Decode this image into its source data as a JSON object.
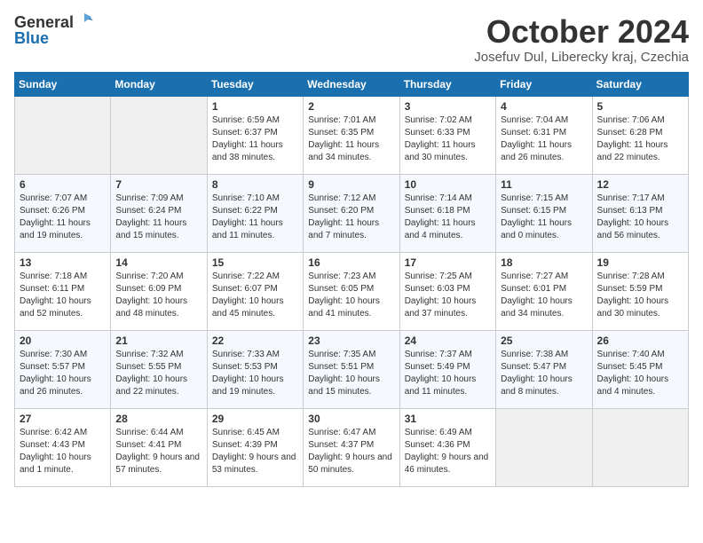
{
  "header": {
    "logo_general": "General",
    "logo_blue": "Blue",
    "month": "October 2024",
    "location": "Josefuv Dul, Liberecky kraj, Czechia"
  },
  "weekdays": [
    "Sunday",
    "Monday",
    "Tuesday",
    "Wednesday",
    "Thursday",
    "Friday",
    "Saturday"
  ],
  "weeks": [
    [
      {
        "day": "",
        "info": ""
      },
      {
        "day": "",
        "info": ""
      },
      {
        "day": "1",
        "info": "Sunrise: 6:59 AM\nSunset: 6:37 PM\nDaylight: 11 hours and 38 minutes."
      },
      {
        "day": "2",
        "info": "Sunrise: 7:01 AM\nSunset: 6:35 PM\nDaylight: 11 hours and 34 minutes."
      },
      {
        "day": "3",
        "info": "Sunrise: 7:02 AM\nSunset: 6:33 PM\nDaylight: 11 hours and 30 minutes."
      },
      {
        "day": "4",
        "info": "Sunrise: 7:04 AM\nSunset: 6:31 PM\nDaylight: 11 hours and 26 minutes."
      },
      {
        "day": "5",
        "info": "Sunrise: 7:06 AM\nSunset: 6:28 PM\nDaylight: 11 hours and 22 minutes."
      }
    ],
    [
      {
        "day": "6",
        "info": "Sunrise: 7:07 AM\nSunset: 6:26 PM\nDaylight: 11 hours and 19 minutes."
      },
      {
        "day": "7",
        "info": "Sunrise: 7:09 AM\nSunset: 6:24 PM\nDaylight: 11 hours and 15 minutes."
      },
      {
        "day": "8",
        "info": "Sunrise: 7:10 AM\nSunset: 6:22 PM\nDaylight: 11 hours and 11 minutes."
      },
      {
        "day": "9",
        "info": "Sunrise: 7:12 AM\nSunset: 6:20 PM\nDaylight: 11 hours and 7 minutes."
      },
      {
        "day": "10",
        "info": "Sunrise: 7:14 AM\nSunset: 6:18 PM\nDaylight: 11 hours and 4 minutes."
      },
      {
        "day": "11",
        "info": "Sunrise: 7:15 AM\nSunset: 6:15 PM\nDaylight: 11 hours and 0 minutes."
      },
      {
        "day": "12",
        "info": "Sunrise: 7:17 AM\nSunset: 6:13 PM\nDaylight: 10 hours and 56 minutes."
      }
    ],
    [
      {
        "day": "13",
        "info": "Sunrise: 7:18 AM\nSunset: 6:11 PM\nDaylight: 10 hours and 52 minutes."
      },
      {
        "day": "14",
        "info": "Sunrise: 7:20 AM\nSunset: 6:09 PM\nDaylight: 10 hours and 48 minutes."
      },
      {
        "day": "15",
        "info": "Sunrise: 7:22 AM\nSunset: 6:07 PM\nDaylight: 10 hours and 45 minutes."
      },
      {
        "day": "16",
        "info": "Sunrise: 7:23 AM\nSunset: 6:05 PM\nDaylight: 10 hours and 41 minutes."
      },
      {
        "day": "17",
        "info": "Sunrise: 7:25 AM\nSunset: 6:03 PM\nDaylight: 10 hours and 37 minutes."
      },
      {
        "day": "18",
        "info": "Sunrise: 7:27 AM\nSunset: 6:01 PM\nDaylight: 10 hours and 34 minutes."
      },
      {
        "day": "19",
        "info": "Sunrise: 7:28 AM\nSunset: 5:59 PM\nDaylight: 10 hours and 30 minutes."
      }
    ],
    [
      {
        "day": "20",
        "info": "Sunrise: 7:30 AM\nSunset: 5:57 PM\nDaylight: 10 hours and 26 minutes."
      },
      {
        "day": "21",
        "info": "Sunrise: 7:32 AM\nSunset: 5:55 PM\nDaylight: 10 hours and 22 minutes."
      },
      {
        "day": "22",
        "info": "Sunrise: 7:33 AM\nSunset: 5:53 PM\nDaylight: 10 hours and 19 minutes."
      },
      {
        "day": "23",
        "info": "Sunrise: 7:35 AM\nSunset: 5:51 PM\nDaylight: 10 hours and 15 minutes."
      },
      {
        "day": "24",
        "info": "Sunrise: 7:37 AM\nSunset: 5:49 PM\nDaylight: 10 hours and 11 minutes."
      },
      {
        "day": "25",
        "info": "Sunrise: 7:38 AM\nSunset: 5:47 PM\nDaylight: 10 hours and 8 minutes."
      },
      {
        "day": "26",
        "info": "Sunrise: 7:40 AM\nSunset: 5:45 PM\nDaylight: 10 hours and 4 minutes."
      }
    ],
    [
      {
        "day": "27",
        "info": "Sunrise: 6:42 AM\nSunset: 4:43 PM\nDaylight: 10 hours and 1 minute."
      },
      {
        "day": "28",
        "info": "Sunrise: 6:44 AM\nSunset: 4:41 PM\nDaylight: 9 hours and 57 minutes."
      },
      {
        "day": "29",
        "info": "Sunrise: 6:45 AM\nSunset: 4:39 PM\nDaylight: 9 hours and 53 minutes."
      },
      {
        "day": "30",
        "info": "Sunrise: 6:47 AM\nSunset: 4:37 PM\nDaylight: 9 hours and 50 minutes."
      },
      {
        "day": "31",
        "info": "Sunrise: 6:49 AM\nSunset: 4:36 PM\nDaylight: 9 hours and 46 minutes."
      },
      {
        "day": "",
        "info": ""
      },
      {
        "day": "",
        "info": ""
      }
    ]
  ]
}
